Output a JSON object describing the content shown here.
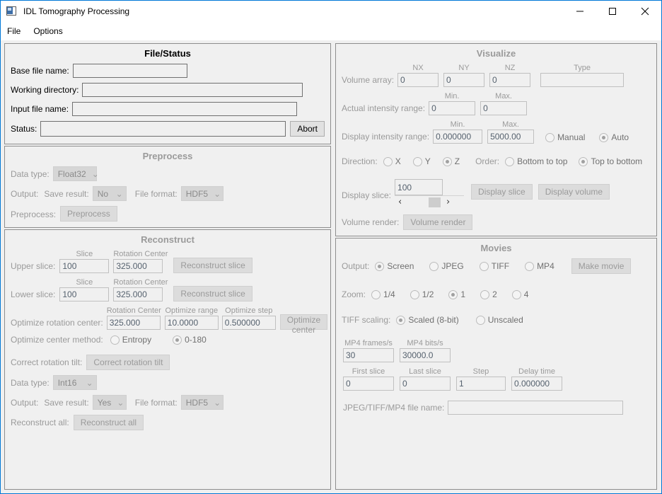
{
  "window": {
    "title": "IDL Tomography Processing",
    "icon": "app-window-icon",
    "minimize": "–",
    "maximize": "□",
    "close": "✕"
  },
  "menu": {
    "items": [
      {
        "label": "File"
      },
      {
        "label": "Options"
      }
    ]
  },
  "file_status": {
    "title": "File/Status",
    "base_file_name_label": "Base file name:",
    "base_file_name_value": "",
    "working_directory_label": "Working directory:",
    "working_directory_value": "",
    "input_file_name_label": "Input file name:",
    "input_file_name_value": "",
    "status_label": "Status:",
    "status_value": "",
    "abort_label": "Abort"
  },
  "preprocess": {
    "title": "Preprocess",
    "data_type_label": "Data type:",
    "data_type_value": "Float32",
    "output_label": "Output:",
    "save_result_label": "Save result:",
    "save_result_value": "No",
    "file_format_label": "File format:",
    "file_format_value": "HDF5",
    "preprocess_label": "Preprocess:",
    "preprocess_button": "Preprocess"
  },
  "reconstruct": {
    "title": "Reconstruct",
    "slice_caption": "Slice",
    "rotation_center_caption": "Rotation Center",
    "upper_slice_label": "Upper slice:",
    "upper_slice_value": "100",
    "upper_rotation_center_value": "325.000",
    "upper_reconstruct_button": "Reconstruct slice",
    "lower_slice_label": "Lower slice:",
    "lower_slice_value": "100",
    "lower_rotation_center_value": "325.000",
    "lower_reconstruct_button": "Reconstruct slice",
    "optimize_label": "Optimize rotation center:",
    "optimize_rotation_center_caption": "Rotation Center",
    "optimize_range_caption": "Optimize range",
    "optimize_step_caption": "Optimize step",
    "optimize_rotation_center_value": "325.000",
    "optimize_range_value": "10.0000",
    "optimize_step_value": "0.500000",
    "optimize_center_button": "Optimize center",
    "optimize_method_label": "Optimize center method:",
    "optimize_methods": [
      {
        "label": "Entropy",
        "selected": false
      },
      {
        "label": "0-180",
        "selected": true
      }
    ],
    "correct_tilt_label": "Correct rotation tilt:",
    "correct_tilt_button": "Correct rotation tilt",
    "data_type_label": "Data type:",
    "data_type_value": "Int16",
    "output_label": "Output:",
    "save_result_label": "Save result:",
    "save_result_value": "Yes",
    "file_format_label": "File format:",
    "file_format_value": "HDF5",
    "reconstruct_all_label": "Reconstruct all:",
    "reconstruct_all_button": "Reconstruct all"
  },
  "visualize": {
    "title": "Visualize",
    "volume_array_label": "Volume array:",
    "nx_caption": "NX",
    "ny_caption": "NY",
    "nz_caption": "NZ",
    "type_caption": "Type",
    "nx_value": "0",
    "ny_value": "0",
    "nz_value": "0",
    "type_value": "",
    "actual_range_label": "Actual intensity range:",
    "min_caption": "Min.",
    "max_caption": "Max.",
    "actual_min_value": "0",
    "actual_max_value": "0",
    "display_range_label": "Display intensity range:",
    "display_min_caption": "Min.",
    "display_max_caption": "Max.",
    "display_min_value": "0.000000",
    "display_max_value": "5000.00",
    "scaling_modes": [
      {
        "label": "Manual",
        "selected": false
      },
      {
        "label": "Auto",
        "selected": true
      }
    ],
    "direction_label": "Direction:",
    "directions": [
      {
        "label": "X",
        "selected": false
      },
      {
        "label": "Y",
        "selected": false
      },
      {
        "label": "Z",
        "selected": true
      }
    ],
    "order_label": "Order:",
    "orders": [
      {
        "label": "Bottom to top",
        "selected": false
      },
      {
        "label": "Top to bottom",
        "selected": true
      }
    ],
    "display_slice_label": "Display slice:",
    "display_slice_value": "100",
    "display_slice_button": "Display slice",
    "display_volume_button": "Display volume",
    "slider_left": "‹",
    "slider_right": "›",
    "volume_render_label": "Volume render:",
    "volume_render_button": "Volume render"
  },
  "movies": {
    "title": "Movies",
    "output_label": "Output:",
    "outputs": [
      {
        "label": "Screen",
        "selected": true
      },
      {
        "label": "JPEG",
        "selected": false
      },
      {
        "label": "TIFF",
        "selected": false
      },
      {
        "label": "MP4",
        "selected": false
      }
    ],
    "make_movie_button": "Make movie",
    "zoom_label": "Zoom:",
    "zooms": [
      {
        "label": "1/4",
        "selected": false
      },
      {
        "label": "1/2",
        "selected": false
      },
      {
        "label": "1",
        "selected": true
      },
      {
        "label": "2",
        "selected": false
      },
      {
        "label": "4",
        "selected": false
      }
    ],
    "tiff_scaling_label": "TIFF scaling:",
    "tiff_scalings": [
      {
        "label": "Scaled (8-bit)",
        "selected": true
      },
      {
        "label": "Unscaled",
        "selected": false
      }
    ],
    "mp4_frames_caption": "MP4 frames/s",
    "mp4_frames_value": "30",
    "mp4_bits_caption": "MP4 bits/s",
    "mp4_bits_value": "30000.0",
    "first_slice_caption": "First slice",
    "first_slice_value": "0",
    "last_slice_caption": "Last slice",
    "last_slice_value": "0",
    "step_caption": "Step",
    "step_value": "1",
    "delay_time_caption": "Delay time",
    "delay_time_value": "0.000000",
    "file_name_label": "JPEG/TIFF/MP4 file name:",
    "file_name_value": ""
  },
  "colors": {
    "accent": "#0078d7",
    "panel_bg": "#f0f0f0",
    "panel_border": "#8d8d8d",
    "disabled_text": "#9a9a9a",
    "field_text": "#55616e"
  }
}
